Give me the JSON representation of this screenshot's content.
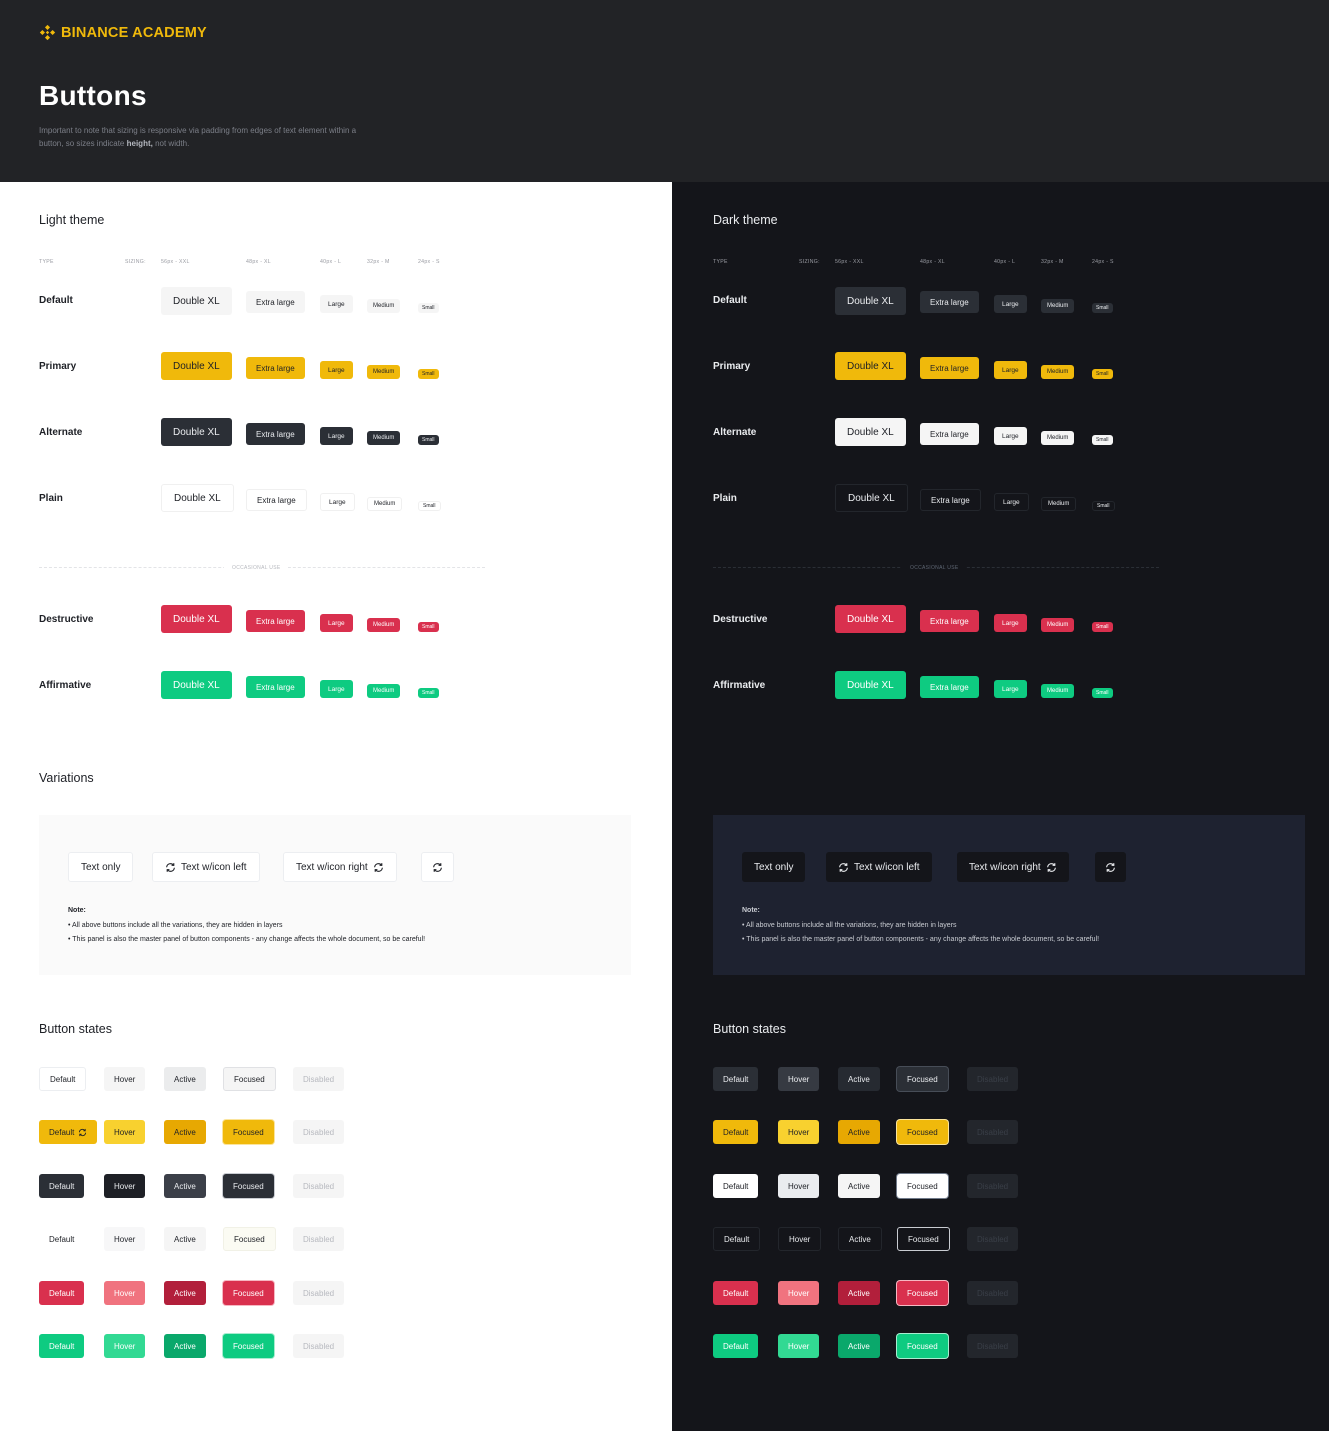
{
  "brand": {
    "name": "BINANCE ACADEMY"
  },
  "header": {
    "title": "Buttons",
    "subtitle_a": "Important to note that sizing is responsive via padding from edges of text element within a button, so sizes indicate",
    "subtitle_b": "height,",
    "subtitle_c": "not width."
  },
  "columns": {
    "type": "TYPE",
    "sizing": "SIZING:",
    "xxl": "56px - XXL",
    "xl": "48px - XL",
    "l": "40px - L",
    "m": "32px - M",
    "s": "24px - S"
  },
  "sizes": {
    "xxl": "Double XL",
    "xl": "Extra large",
    "l": "Large",
    "m": "Medium",
    "s": "Small"
  },
  "rows": {
    "default": "Default",
    "primary": "Primary",
    "alternate": "Alternate",
    "plain": "Plain",
    "destructive": "Destructive",
    "affirmative": "Affirmative"
  },
  "divider": "OCCASIONAL USE",
  "light": {
    "title": "Light theme"
  },
  "dark": {
    "title": "Dark theme"
  },
  "variations": {
    "title": "Variations",
    "text_only": "Text only",
    "icon_left": "Text w/icon left",
    "icon_right": "Text w/icon right",
    "note_title": "Note:",
    "note_1": "• All above buttons include all the variations, they are hidden in layers",
    "note_2": "• This panel is also the master panel of button components - any change affects the whole document, so be careful!"
  },
  "states": {
    "title": "Button states",
    "default": "Default",
    "hover": "Hover",
    "active": "Active",
    "focused": "Focused",
    "disabled": "Disabled"
  },
  "colors": {
    "primary": "#f0b90b",
    "alternate_light": "#2b2f36",
    "destructive": "#d9304e",
    "affirmative": "#0ecb81",
    "header_bg": "#222326",
    "dark_bg": "#14151a"
  },
  "icons": {
    "logo": "binance-logo-icon",
    "refresh": "refresh-icon"
  }
}
